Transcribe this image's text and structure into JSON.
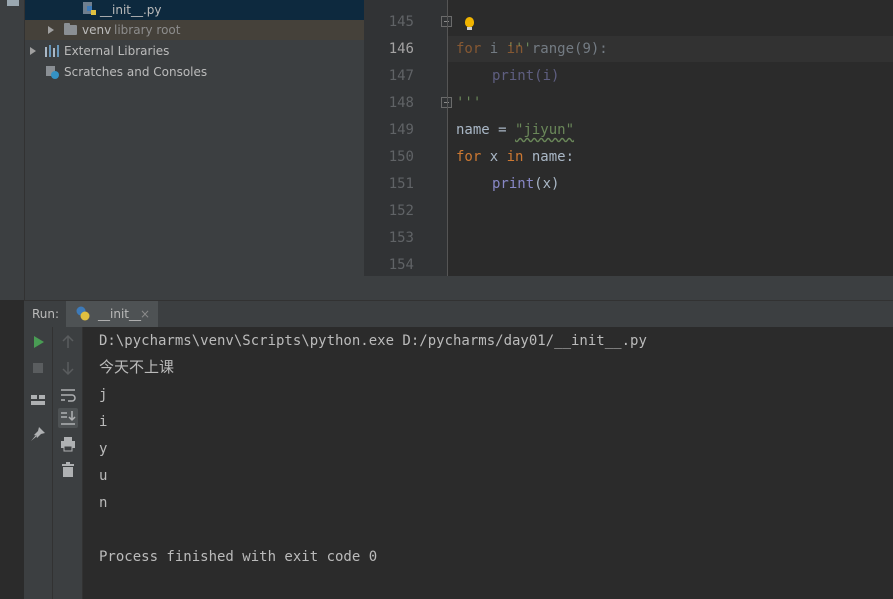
{
  "project_tree": {
    "items": [
      {
        "label": "__init__.py"
      },
      {
        "label": "venv",
        "sublabel": "library root"
      },
      {
        "label": "External Libraries"
      },
      {
        "label": "Scratches and Consoles"
      }
    ]
  },
  "editor": {
    "line_numbers": [
      "145",
      "146",
      "147",
      "148",
      "149",
      "150",
      "151",
      "152",
      "153",
      "154"
    ],
    "current_line": "146",
    "code": {
      "l145_quote": "'''",
      "l146_for": "for",
      "l146_i": " i ",
      "l146_in": "in",
      "l146_range": " range(9):",
      "l147_print": "print(i)",
      "l148_quote": "'''",
      "l149_name": "name = ",
      "l149_str": "\"jiyun\"",
      "l150_for": "for",
      "l150_x": " x ",
      "l150_in": "in",
      "l150_rest": " name:",
      "l151_print": "print",
      "l151_args": "(x)"
    }
  },
  "run_panel": {
    "title": "Run:",
    "tab_label": "__init__",
    "tab_close": "×",
    "console": [
      "D:\\pycharms\\venv\\Scripts\\python.exe D:/pycharms/day01/__init__.py",
      "今天不上课",
      "j",
      "i",
      "y",
      "u",
      "n",
      "",
      "Process finished with exit code 0"
    ]
  },
  "colors": {
    "keyword": "#cc7832",
    "string": "#6a8759",
    "builtin": "#8888c6",
    "text": "#a9b7c6",
    "run_green": "#499c54"
  }
}
